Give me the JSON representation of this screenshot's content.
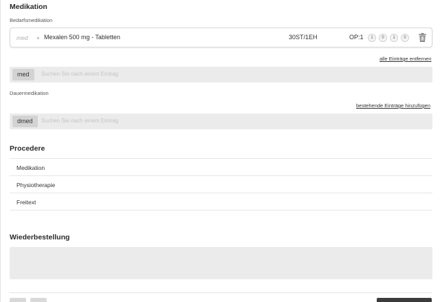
{
  "medikation": {
    "title": "Medikation",
    "bedarf_label": "Bedarfsmedikation",
    "entry": {
      "tag": "med",
      "name": "Mexalen 500 mg - Tabletten",
      "quantity": "30ST/1EH",
      "op": "OP:1",
      "doses": [
        "1",
        "0",
        "1",
        "0"
      ]
    },
    "remove_all_link": "alle Einträge entfernen",
    "bedarf_search": {
      "chip": "med",
      "placeholder": "Suchen Sie nach einem Eintrag"
    },
    "dauer_label": "Dauermedikation",
    "add_existing_link": "bestehende Einträge hinzufügen",
    "dauer_search": {
      "chip": "dmed",
      "placeholder": "Suchen Sie nach einem Eintrag"
    }
  },
  "procedere": {
    "title": "Procedere",
    "items": [
      "Medikation",
      "Physiotherapie",
      "Freitext"
    ]
  },
  "wiederbestellung": {
    "title": "Wiederbestellung",
    "text": ""
  }
}
